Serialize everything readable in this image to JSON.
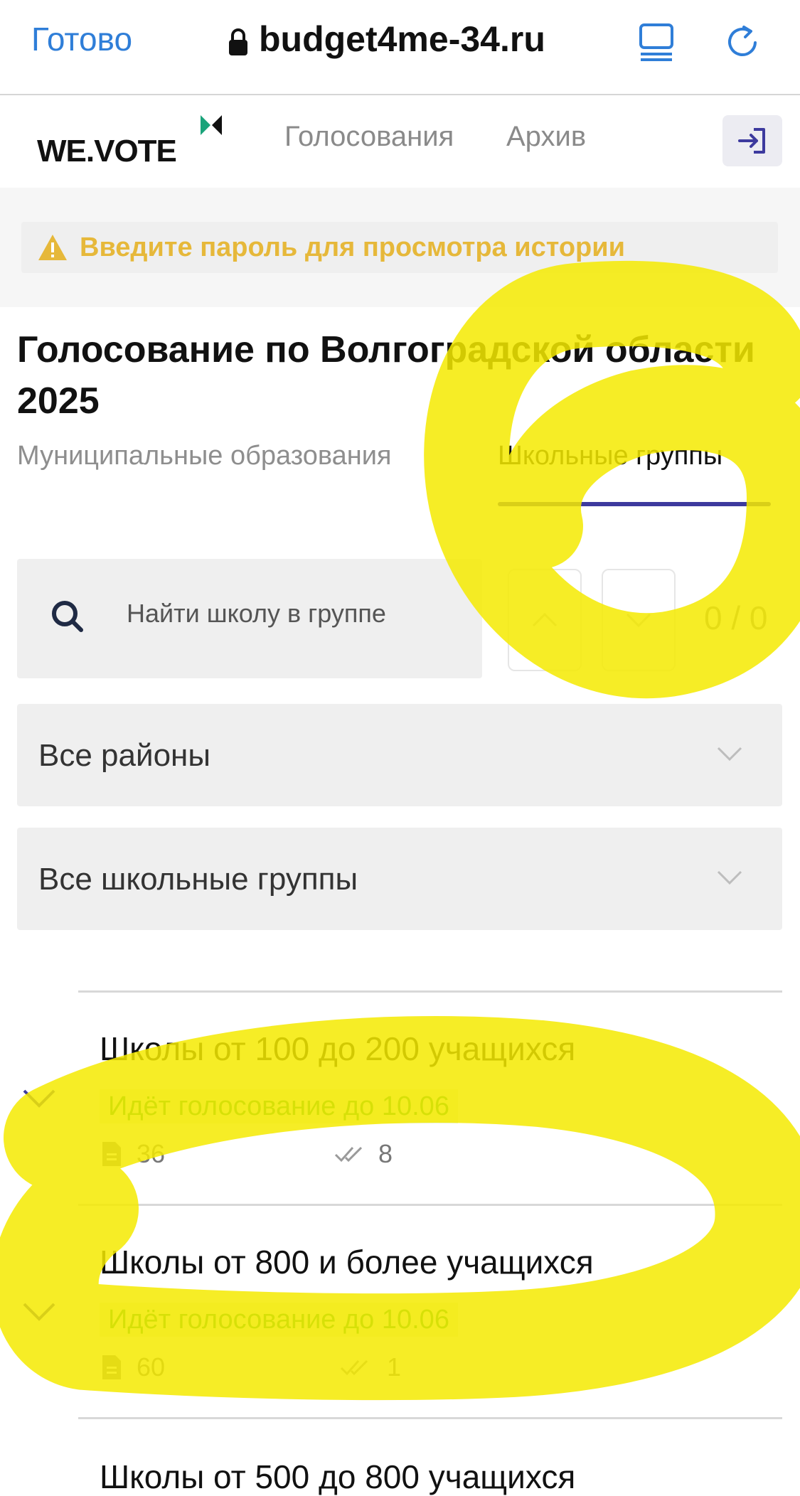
{
  "browser": {
    "done_label": "Готово",
    "url": "budget4me-34.ru"
  },
  "app": {
    "logo": "WE.VOTE",
    "nav": [
      "Голосования",
      "Архив"
    ]
  },
  "warning": "Введите пароль для просмотра истории",
  "page": {
    "title": "Голосование по Волгоградской области 2025",
    "tabs": [
      "Муниципальные образования",
      "Школьные группы"
    ],
    "active_tab": "Школьные группы"
  },
  "search": {
    "placeholder": "Найти школу в группе",
    "counter": "0 / 0"
  },
  "filters": {
    "district": "Все районы",
    "group": "Все школьные группы"
  },
  "groups": [
    {
      "title": "Школы от 100 до 200 учащихся",
      "status": "Идёт голосование до 10.06",
      "projects": "36",
      "votes": "8"
    },
    {
      "title": "Школы от 800 и более учащихся",
      "status": "Идёт голосование до 10.06",
      "projects": "60",
      "votes": "1"
    },
    {
      "title": "Школы от 500 до 800 учащихся"
    }
  ],
  "colors": {
    "link": "#2f7ed8",
    "accent": "#3d3a9e",
    "warning": "#e6b83a",
    "status_green": "#2ea82e",
    "highlighter": "#f4ea00"
  }
}
